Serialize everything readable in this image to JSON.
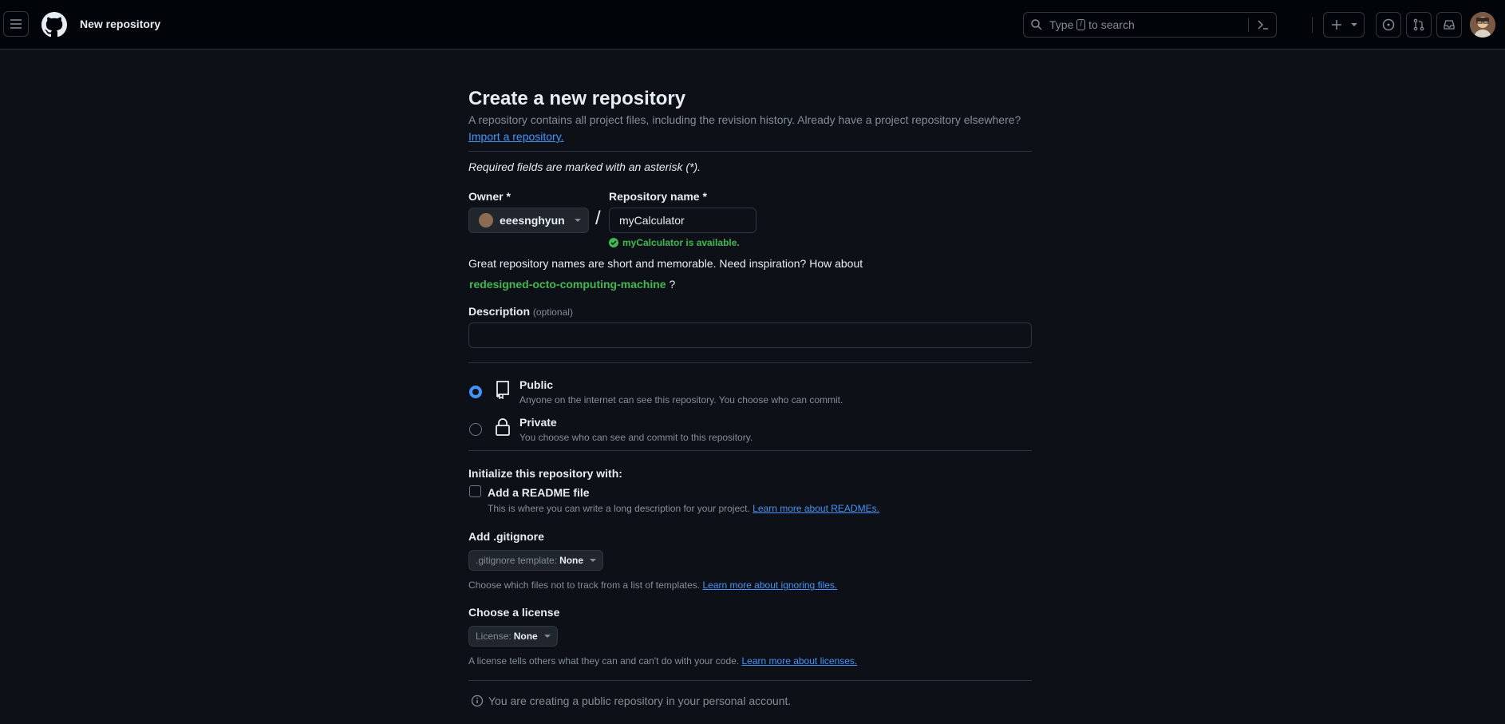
{
  "header": {
    "page_name": "New repository",
    "search_prefix": "Type",
    "search_key": "/",
    "search_suffix": "to search"
  },
  "main": {
    "title": "Create a new repository",
    "description": "A repository contains all project files, including the revision history. Already have a project repository elsewhere?",
    "import_link": "Import a repository.",
    "required_note": "Required fields are marked with an asterisk (*).",
    "owner_label": "Owner *",
    "owner_value": "eeesnghyun",
    "slash": "/",
    "repo_label": "Repository name *",
    "repo_value": "myCalculator",
    "availability": "myCalculator is available.",
    "inspiration": "Great repository names are short and memorable. Need inspiration? How about",
    "suggestion": "redesigned-octo-computing-machine",
    "suggestion_q": " ?",
    "description_label": "Description",
    "description_optional": "(optional)",
    "description_value": "",
    "visibility": {
      "public_title": "Public",
      "public_sub": "Anyone on the internet can see this repository. You choose who can commit.",
      "private_title": "Private",
      "private_sub": "You choose who can see and commit to this repository.",
      "selected": "Public"
    },
    "init_label": "Initialize this repository with:",
    "readme_label": "Add a README file",
    "readme_sub": "This is where you can write a long description for your project.",
    "readme_link": "Learn more about READMEs.",
    "readme_checked": false,
    "gitignore_label": "Add .gitignore",
    "gitignore_prefix": ".gitignore template:",
    "gitignore_value": "None",
    "gitignore_note": "Choose which files not to track from a list of templates.",
    "gitignore_link": "Learn more about ignoring files.",
    "license_label": "Choose a license",
    "license_prefix": "License:",
    "license_value": "None",
    "license_note": "A license tells others what they can and can't do with your code.",
    "license_link": "Learn more about licenses.",
    "info_note": "You are creating a public repository in your personal account."
  },
  "colors": {
    "background": "#0d1117",
    "header": "#010409",
    "accent": "#4493f8",
    "success": "#3fb950",
    "border": "#30363d"
  }
}
